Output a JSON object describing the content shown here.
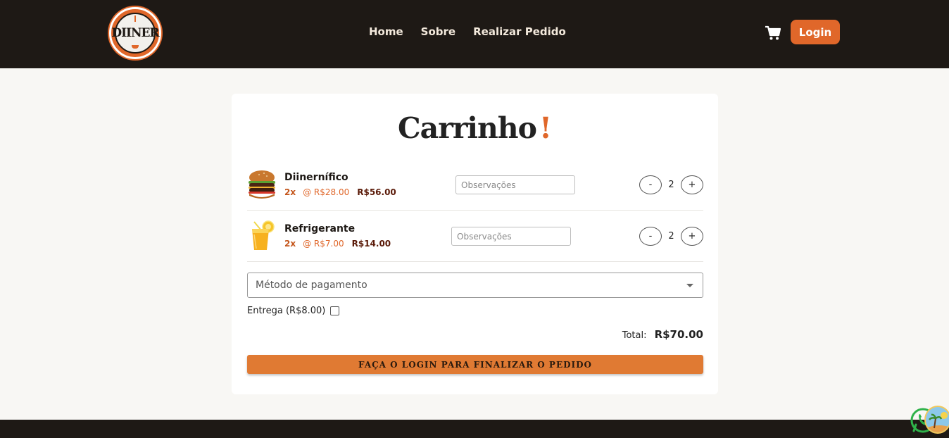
{
  "header": {
    "logo_label": "DIINER",
    "nav": [
      "Home",
      "Sobre",
      "Realizar Pedido"
    ],
    "login_label": "Login",
    "cart_icon": "shopping-cart-icon"
  },
  "cart": {
    "title": "Carrinho",
    "title_mark": "!",
    "items": [
      {
        "name": "Diinernífico",
        "qty_label": "2x",
        "unit_price": "@ R$28.00",
        "subtotal": "R$56.00",
        "obs_placeholder": "Observações",
        "quantity": "2",
        "icon": "burger-icon"
      },
      {
        "name": "Refrigerante",
        "qty_label": "2x",
        "unit_price": "@ R$7.00",
        "subtotal": "R$14.00",
        "obs_placeholder": "Observações",
        "quantity": "2",
        "icon": "soda-icon"
      }
    ],
    "decrement_label": "-",
    "increment_label": "+",
    "payment_placeholder": "Método de pagamento",
    "delivery_label": "Entrega (R$8.00)",
    "total_label": "Total:",
    "total_value": "R$70.00",
    "checkout_label": "FAÇA O LOGIN PARA FINALIZAR O PEDIDO"
  },
  "colors": {
    "header_bg": "#1e1915",
    "accent": "#e0672a",
    "button": "#e07a33",
    "page_bg": "#f8f7f4"
  }
}
